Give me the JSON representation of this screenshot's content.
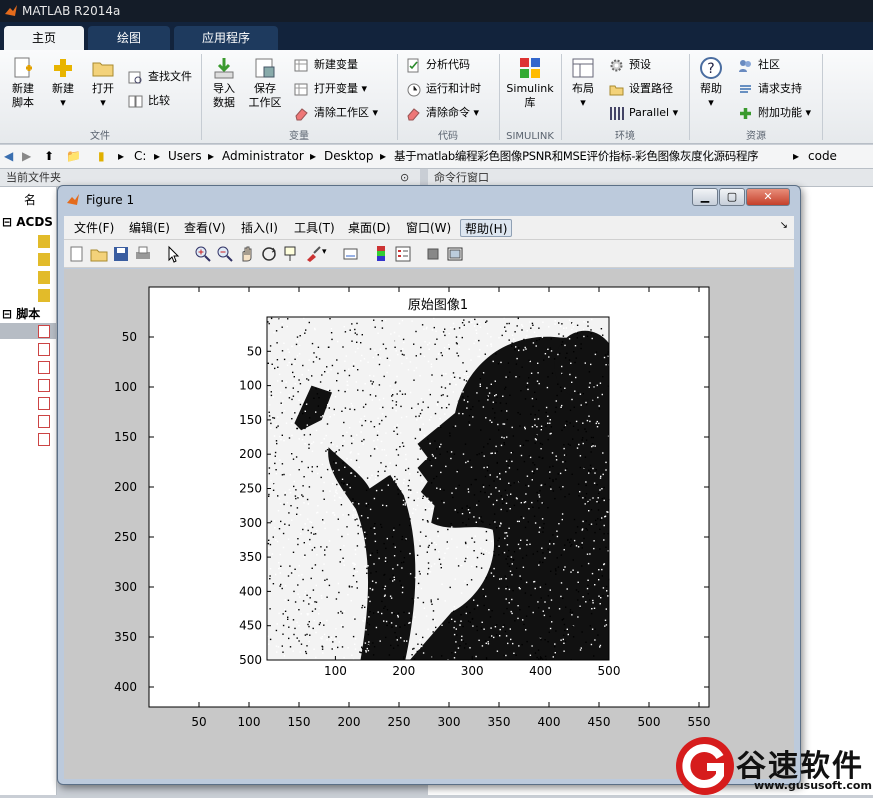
{
  "app_title": "MATLAB R2014a",
  "tabs": [
    "主页",
    "绘图",
    "应用程序"
  ],
  "ribbon": {
    "file": {
      "new_script": "新建\n脚本",
      "new": "新建",
      "open": "打开",
      "find_files": "查找文件",
      "compare": "比较",
      "group": "文件"
    },
    "variable": {
      "import": "导入\n数据",
      "save_ws": "保存\n工作区",
      "new_var": "新建变量",
      "open_var": "打开变量",
      "clear_ws": "清除工作区",
      "group": "变量"
    },
    "code": {
      "analyze": "分析代码",
      "run_time": "运行和计时",
      "clear_cmd": "清除命令",
      "group": "代码"
    },
    "simulink": {
      "label": "Simulink\n库",
      "group": "SIMULINK"
    },
    "env": {
      "layout": "布局",
      "prefs": "预设",
      "set_path": "设置路径",
      "parallel": "Parallel",
      "group": "环境"
    },
    "resources": {
      "help": "帮助",
      "community": "社区",
      "support": "请求支持",
      "addons": "附加功能",
      "group": "资源"
    }
  },
  "address": [
    "C:",
    "Users",
    "Administrator",
    "Desktop",
    "基于matlab编程彩色图像PSNR和MSE评价指标-彩色图像灰度化源码程序",
    "code"
  ],
  "panes": {
    "current_folder": "当前文件夹",
    "command_window": "命令行窗口",
    "name_col": "名",
    "folder1": "ACDS",
    "folder2": "脚本"
  },
  "figure": {
    "title": "Figure 1",
    "menu": [
      "文件(F)",
      "编辑(E)",
      "查看(V)",
      "插入(I)",
      "工具(T)",
      "桌面(D)",
      "窗口(W)",
      "帮助(H)"
    ],
    "toolbar_icons": [
      "new-figure-icon",
      "open-icon",
      "save-icon",
      "print-icon",
      "pointer-icon",
      "zoom-in-icon",
      "zoom-out-icon",
      "pan-icon",
      "rotate-icon",
      "data-cursor-icon",
      "brush-icon",
      "link-icon",
      "colorbar-icon",
      "legend-icon",
      "hide-tools-icon",
      "show-tools-icon"
    ],
    "axes_title": "原始图像1"
  },
  "chart_data": [
    {
      "type": "image-axes",
      "outer_axes": {
        "xticks": [
          50,
          100,
          150,
          200,
          250,
          300,
          350,
          400,
          450,
          500,
          550
        ],
        "yticks": [
          50,
          100,
          150,
          200,
          250,
          300,
          350,
          400
        ],
        "xlim": [
          0,
          560
        ],
        "ylim": [
          0,
          420
        ]
      },
      "inner_axes": {
        "title": "原始图像1",
        "xticks": [
          100,
          200,
          300,
          400,
          500
        ],
        "yticks": [
          50,
          100,
          150,
          200,
          250,
          300,
          350,
          400,
          450,
          500
        ],
        "xlim": [
          0,
          500
        ],
        "ylim": [
          0,
          500
        ]
      }
    }
  ],
  "watermark": {
    "text": "谷速软件",
    "url": "www.gususoft.com"
  }
}
